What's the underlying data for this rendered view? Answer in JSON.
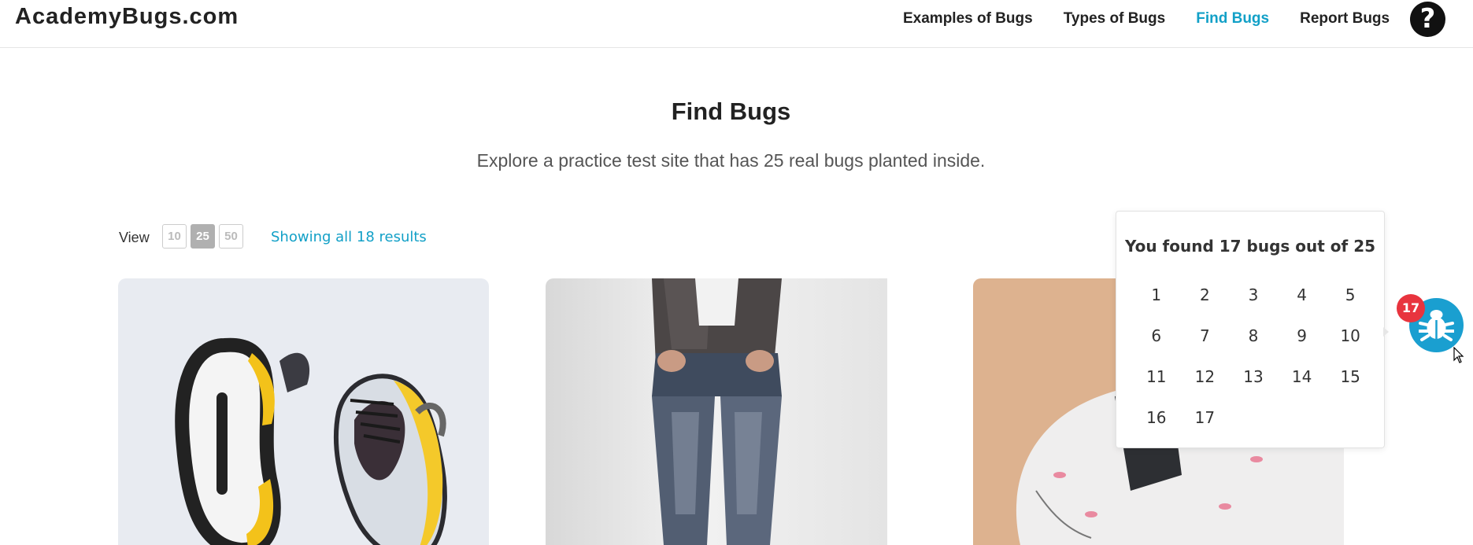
{
  "header": {
    "logo": "AcademyBugs.com",
    "nav": [
      {
        "label": "Examples of Bugs"
      },
      {
        "label": "Types of Bugs"
      },
      {
        "label": "Find Bugs",
        "active": true
      },
      {
        "label": "Report Bugs"
      }
    ],
    "help_glyph": "?"
  },
  "page": {
    "title": "Find Bugs",
    "subtitle": "Explore a practice test site that has 25 real bugs planted inside."
  },
  "view": {
    "label": "View",
    "options": [
      "10",
      "25",
      "50"
    ],
    "selected": "25",
    "results_text": "Showing all 18 results"
  },
  "products": [
    {
      "image": "sneakers-product-image"
    },
    {
      "image": "jeans-product-image"
    },
    {
      "image": "flamingo-shorts-product-image"
    }
  ],
  "bug_tracker": {
    "title": "You found 17 bugs out of 25",
    "found": [
      "1",
      "2",
      "3",
      "4",
      "5",
      "6",
      "7",
      "8",
      "9",
      "10",
      "11",
      "12",
      "13",
      "14",
      "15",
      "16",
      "17"
    ],
    "badge_count": "17",
    "accent": "#1a9fd0",
    "badge_color": "#e8343e"
  },
  "colors": {
    "link": "#12a0c7",
    "text": "#222222"
  }
}
